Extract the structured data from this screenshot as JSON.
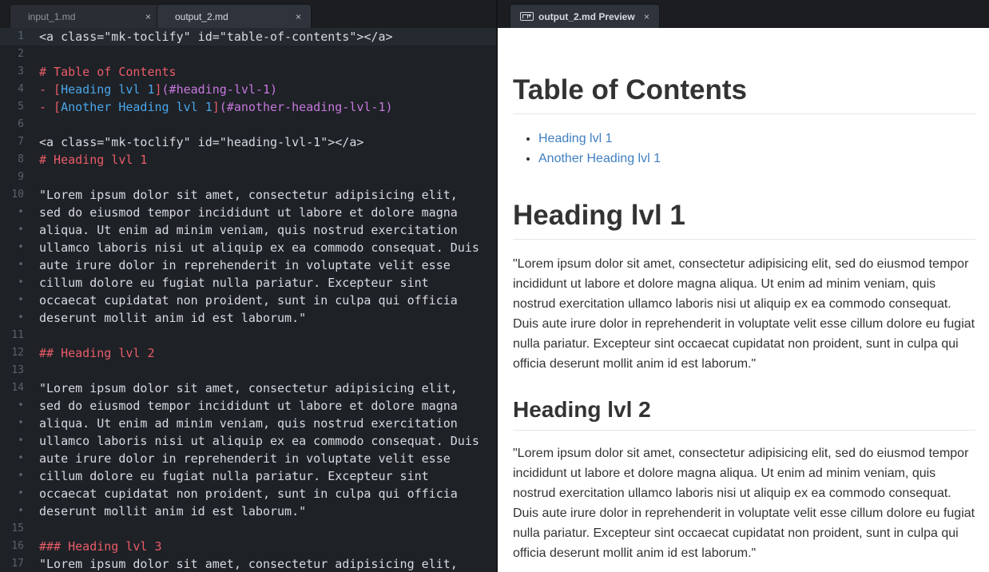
{
  "tabs": [
    {
      "label": "input_1.md",
      "active": false,
      "close": "×"
    },
    {
      "label": "output_2.md",
      "active": true,
      "close": "×"
    },
    {
      "label": "output_2.md Preview",
      "active": true,
      "close": "×",
      "icon": "markdown-icon"
    }
  ],
  "editor": {
    "lines": [
      {
        "num": "1",
        "segments": [
          {
            "t": "<a class=\"mk-toclify\" id=\"table-of-contents\"></a>",
            "c": "plain"
          }
        ]
      },
      {
        "num": "2",
        "segments": []
      },
      {
        "num": "3",
        "segments": [
          {
            "t": "# Table of Contents",
            "c": "heading"
          }
        ]
      },
      {
        "num": "4",
        "segments": [
          {
            "t": "- [",
            "c": "heading"
          },
          {
            "t": "Heading lvl 1",
            "c": "link-text"
          },
          {
            "t": "]",
            "c": "heading"
          },
          {
            "t": "(#heading-lvl-1)",
            "c": "link-url"
          }
        ]
      },
      {
        "num": "5",
        "segments": [
          {
            "t": "- [",
            "c": "heading"
          },
          {
            "t": "Another Heading lvl 1",
            "c": "link-text"
          },
          {
            "t": "]",
            "c": "heading"
          },
          {
            "t": "(#another-heading-lvl-1)",
            "c": "link-url"
          }
        ]
      },
      {
        "num": "6",
        "segments": []
      },
      {
        "num": "7",
        "segments": [
          {
            "t": "<a class=\"mk-toclify\" id=\"heading-lvl-1\"></a>",
            "c": "plain"
          }
        ]
      },
      {
        "num": "8",
        "segments": [
          {
            "t": "# Heading lvl 1",
            "c": "heading"
          }
        ]
      },
      {
        "num": "9",
        "segments": []
      },
      {
        "num": "10",
        "segments": [
          {
            "t": "\"Lorem ipsum dolor sit amet, consectetur adipisicing elit,",
            "c": "plain"
          }
        ]
      },
      {
        "num": "•",
        "segments": [
          {
            "t": "sed do eiusmod tempor incididunt ut labore et dolore magna",
            "c": "plain"
          }
        ]
      },
      {
        "num": "•",
        "segments": [
          {
            "t": "aliqua. Ut enim ad minim veniam, quis nostrud exercitation",
            "c": "plain"
          }
        ]
      },
      {
        "num": "•",
        "segments": [
          {
            "t": "ullamco laboris nisi ut aliquip ex ea commodo consequat. Duis",
            "c": "plain"
          }
        ]
      },
      {
        "num": "•",
        "segments": [
          {
            "t": "aute irure dolor in reprehenderit in voluptate velit esse",
            "c": "plain"
          }
        ]
      },
      {
        "num": "•",
        "segments": [
          {
            "t": "cillum dolore eu fugiat nulla pariatur. Excepteur sint",
            "c": "plain"
          }
        ]
      },
      {
        "num": "•",
        "segments": [
          {
            "t": "occaecat cupidatat non proident, sunt in culpa qui officia",
            "c": "plain"
          }
        ]
      },
      {
        "num": "•",
        "segments": [
          {
            "t": "deserunt mollit anim id est laborum.\"",
            "c": "plain"
          }
        ]
      },
      {
        "num": "11",
        "segments": []
      },
      {
        "num": "12",
        "segments": [
          {
            "t": "## Heading lvl 2",
            "c": "heading"
          }
        ]
      },
      {
        "num": "13",
        "segments": []
      },
      {
        "num": "14",
        "segments": [
          {
            "t": "\"Lorem ipsum dolor sit amet, consectetur adipisicing elit,",
            "c": "plain"
          }
        ]
      },
      {
        "num": "•",
        "segments": [
          {
            "t": "sed do eiusmod tempor incididunt ut labore et dolore magna",
            "c": "plain"
          }
        ]
      },
      {
        "num": "•",
        "segments": [
          {
            "t": "aliqua. Ut enim ad minim veniam, quis nostrud exercitation",
            "c": "plain"
          }
        ]
      },
      {
        "num": "•",
        "segments": [
          {
            "t": "ullamco laboris nisi ut aliquip ex ea commodo consequat. Duis",
            "c": "plain"
          }
        ]
      },
      {
        "num": "•",
        "segments": [
          {
            "t": "aute irure dolor in reprehenderit in voluptate velit esse",
            "c": "plain"
          }
        ]
      },
      {
        "num": "•",
        "segments": [
          {
            "t": "cillum dolore eu fugiat nulla pariatur. Excepteur sint",
            "c": "plain"
          }
        ]
      },
      {
        "num": "•",
        "segments": [
          {
            "t": "occaecat cupidatat non proident, sunt in culpa qui officia",
            "c": "plain"
          }
        ]
      },
      {
        "num": "•",
        "segments": [
          {
            "t": "deserunt mollit anim id est laborum.\"",
            "c": "plain"
          }
        ]
      },
      {
        "num": "15",
        "segments": []
      },
      {
        "num": "16",
        "segments": [
          {
            "t": "### Heading lvl 3",
            "c": "heading"
          }
        ]
      },
      {
        "num": "17",
        "segments": [
          {
            "t": "\"Lorem ipsum dolor sit amet, consectetur adipisicing elit,",
            "c": "plain"
          }
        ]
      }
    ]
  },
  "preview": {
    "toc_title": "Table of Contents",
    "toc_links": [
      "Heading lvl 1",
      "Another Heading lvl 1"
    ],
    "h1": "Heading lvl 1",
    "p1": "\"Lorem ipsum dolor sit amet, consectetur adipisicing elit, sed do eiusmod tempor incididunt ut labore et dolore magna aliqua. Ut enim ad minim veniam, quis nostrud exercitation ullamco laboris nisi ut aliquip ex ea commodo consequat. Duis aute irure dolor in reprehenderit in voluptate velit esse cillum dolore eu fugiat nulla pariatur. Excepteur sint occaecat cupidatat non proident, sunt in culpa qui officia deserunt mollit anim id est laborum.\"",
    "h2": "Heading lvl 2",
    "p2": "\"Lorem ipsum dolor sit amet, consectetur adipisicing elit, sed do eiusmod tempor incididunt ut labore et dolore magna aliqua. Ut enim ad minim veniam, quis nostrud exercitation ullamco laboris nisi ut aliquip ex ea commodo consequat. Duis aute irure dolor in reprehenderit in voluptate velit esse cillum dolore eu fugiat nulla pariatur. Excepteur sint occaecat cupidatat non proident, sunt in culpa qui officia deserunt mollit anim id est laborum.\""
  },
  "colors": {
    "editor_bg": "#1e2126",
    "heading": "#e95c68",
    "link_text": "#4aa6ea",
    "link_url": "#c678dd",
    "preview_link": "#3f7fc2"
  }
}
